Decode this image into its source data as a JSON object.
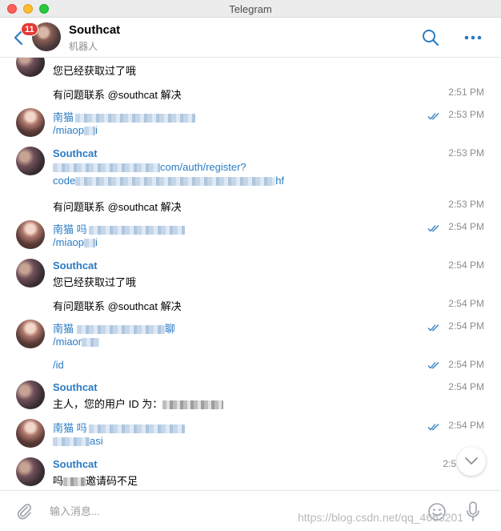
{
  "window": {
    "title": "Telegram"
  },
  "header": {
    "unread_count": "11",
    "chat_name": "Southcat",
    "chat_status": "机器人"
  },
  "icons": {
    "back": "chevron-left-icon",
    "search": "search-icon",
    "more": "more-dots-icon",
    "attach": "paperclip-icon",
    "emoji": "emoji-icon",
    "mic": "microphone-icon",
    "read_receipt": "double-check-icon",
    "scroll_down": "chevron-down-icon"
  },
  "colors": {
    "accent": "#2a7bc4",
    "badge": "#e53935",
    "timestamp": "#8c8c8c"
  },
  "messages": {
    "m0": {
      "text": "您已经获取过了哦"
    },
    "m1": {
      "text": "有问题联系 @southcat 解决",
      "time": "2:51 PM"
    },
    "m2": {
      "sender": "南猫",
      "link": "/miaop",
      "link_tail": "i",
      "time": "2:53 PM"
    },
    "m3": {
      "sender": "Southcat",
      "line1_tail": "com/auth/register?",
      "line2_head": "code",
      "line2_tail": "hf",
      "time": "2:53 PM"
    },
    "m4": {
      "text": "有问题联系 @southcat 解决",
      "time": "2:53 PM"
    },
    "m5": {
      "sender": "南猫 吗",
      "link": "/miaop",
      "link_tail": "i",
      "time": "2:54 PM"
    },
    "m6": {
      "sender": "Southcat",
      "text": "您已经获取过了哦",
      "time": "2:54 PM"
    },
    "m7": {
      "text": "有问题联系 @southcat 解决",
      "time": "2:54 PM"
    },
    "m8": {
      "sender": "南猫",
      "sender_tail": "聊",
      "link": "/miaor",
      "time": "2:54 PM"
    },
    "m9": {
      "text": "/id",
      "time": "2:54 PM"
    },
    "m10": {
      "sender": "Southcat",
      "text": "主人，您的用户 ID 为：",
      "time": "2:54 PM"
    },
    "m11": {
      "sender": "南猫 吗",
      "link_tail": "asi",
      "time": "2:54 PM"
    },
    "m12": {
      "sender": "Southcat",
      "text_head": "吗",
      "text": "邀请码不足",
      "time": "2:5"
    }
  },
  "composer": {
    "placeholder": "输入消息...",
    "watermark": "https://blog.csdn.net/qq_4663201"
  }
}
